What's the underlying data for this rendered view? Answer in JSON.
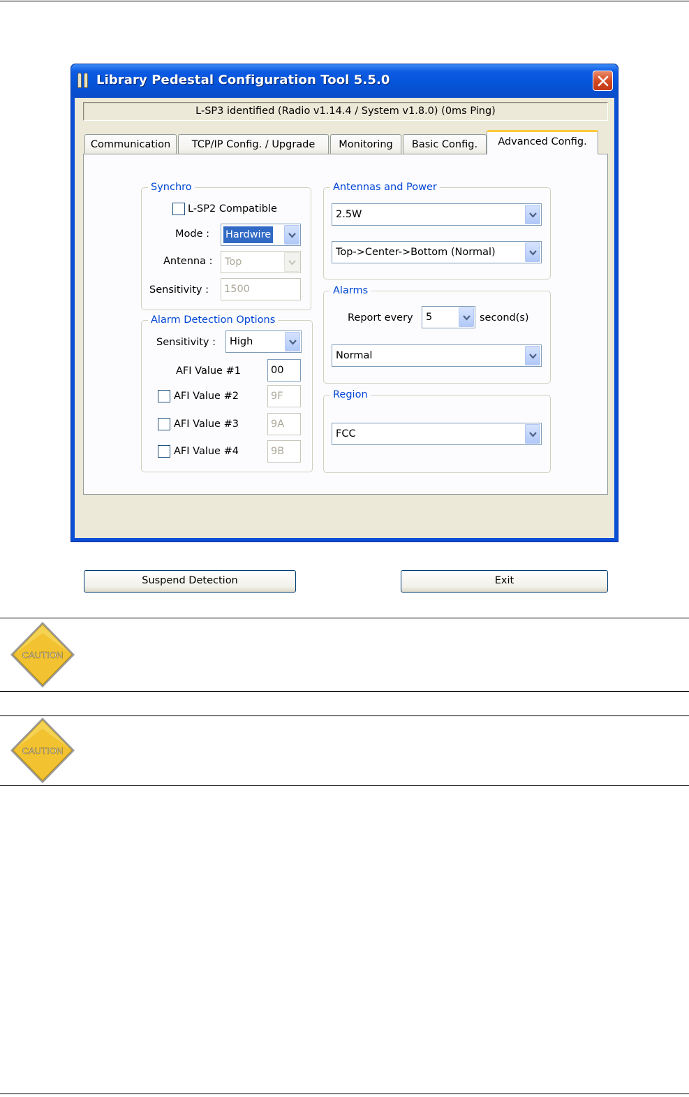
{
  "window": {
    "title": "Library Pedestal Configuration Tool 5.5.0",
    "status": "L-SP3 identified (Radio v1.14.4 / System v1.8.0) (0ms Ping)"
  },
  "tabs": [
    {
      "label": "Communication",
      "active": false
    },
    {
      "label": "TCP/IP Config. / Upgrade",
      "active": false
    },
    {
      "label": "Monitoring",
      "active": false
    },
    {
      "label": "Basic Config.",
      "active": false
    },
    {
      "label": "Advanced Config.",
      "active": true
    }
  ],
  "synchro": {
    "legend": "Synchro",
    "lsp2_label": "L-SP2 Compatible",
    "lsp2_checked": false,
    "mode_label": "Mode :",
    "mode_value": "Hardwire",
    "antenna_label": "Antenna :",
    "antenna_value": "Top",
    "sensitivity_label": "Sensitivity :",
    "sensitivity_value": "1500"
  },
  "alarm_detection": {
    "legend": "Alarm Detection Options",
    "sensitivity_label": "Sensitivity :",
    "sensitivity_value": "High",
    "afi1_label": "AFI Value #1",
    "afi1_value": "00",
    "afi2_label": "AFI Value #2",
    "afi2_value": "9F",
    "afi3_label": "AFI Value #3",
    "afi3_value": "9A",
    "afi4_label": "AFI Value #4",
    "afi4_value": "9B"
  },
  "antennas": {
    "legend": "Antennas and Power",
    "power_value": "2.5W",
    "sequence_value": "Top->Center->Bottom (Normal)"
  },
  "alarms": {
    "legend": "Alarms",
    "report_label": "Report every",
    "report_value": "5",
    "seconds_label": "second(s)",
    "mode_value": "Normal"
  },
  "region": {
    "legend": "Region",
    "value": "FCC"
  },
  "buttons": {
    "suspend": "Suspend Detection",
    "exit": "Exit"
  },
  "caution_text": "CAUTION",
  "colors": {
    "titlebar": "#0553d7",
    "legend": "#0046d5",
    "selection": "#316ac5",
    "caution_fill": "#f2c230"
  }
}
